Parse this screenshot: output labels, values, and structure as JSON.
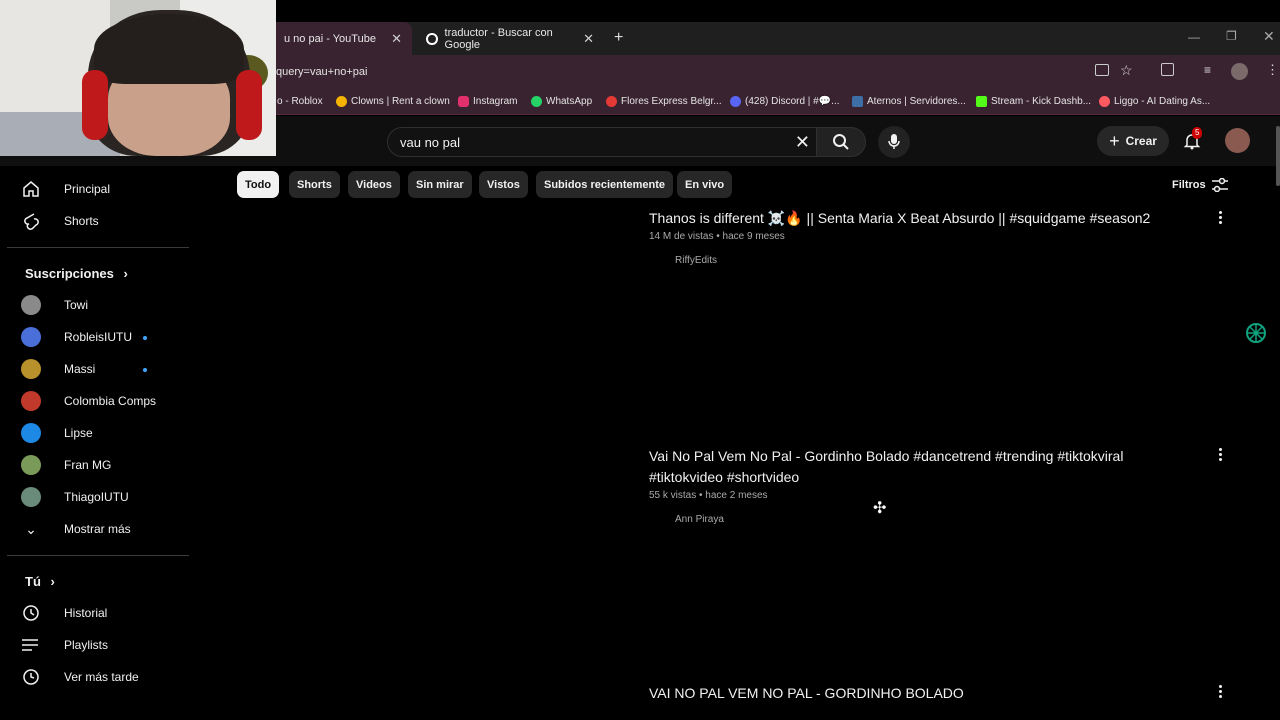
{
  "browser": {
    "tabs": [
      {
        "label": "u no pai - YouTube",
        "active": true
      },
      {
        "label": "traductor - Buscar con Google",
        "active": false
      }
    ],
    "address": "query=vau+no+pai",
    "bookmarks": [
      {
        "label": "o - Roblox",
        "color": "#888888"
      },
      {
        "label": "Clowns | Rent a clown",
        "color": "#f4b400"
      },
      {
        "label": "Instagram",
        "color": "#e1306c"
      },
      {
        "label": "WhatsApp",
        "color": "#25d366"
      },
      {
        "label": "Flores Express Belgr...",
        "color": "#e53935"
      },
      {
        "label": "(428) Discord | #💬...",
        "color": "#5865f2"
      },
      {
        "label": "Aternos | Servidores...",
        "color": "#3d6ea5"
      },
      {
        "label": "Stream - Kick Dashb...",
        "color": "#53fc18"
      },
      {
        "label": "Liggo - AI Dating As...",
        "color": "#ff5a5f"
      }
    ]
  },
  "header": {
    "search_value": "vau no pal",
    "create_label": "Crear",
    "notif_count": "5"
  },
  "chips": [
    "Todo",
    "Shorts",
    "Videos",
    "Sin mirar",
    "Vistos",
    "Subidos recientemente",
    "En vivo"
  ],
  "filters_label": "Filtros",
  "sidebar": {
    "main": [
      {
        "label": "Principal",
        "icon": "home-icon"
      },
      {
        "label": "Shorts",
        "icon": "shorts-icon"
      }
    ],
    "subs_heading": "Suscripciones",
    "subs": [
      {
        "label": "Towi",
        "color": "#8a8a8a",
        "dot": false
      },
      {
        "label": "RobleisIUTU",
        "color": "#4a6fd8",
        "dot": true
      },
      {
        "label": "Massi",
        "color": "#b8902c",
        "dot": true
      },
      {
        "label": "Colombia Comps",
        "color": "#c0392b",
        "dot": false
      },
      {
        "label": "Lipse",
        "color": "#1e88e5",
        "dot": false
      },
      {
        "label": "Fran MG",
        "color": "#7a9a5a",
        "dot": false
      },
      {
        "label": "ThiagoIUTU",
        "color": "#6a8a7a",
        "dot": false
      }
    ],
    "show_more": "Mostrar más",
    "you_heading": "Tú",
    "you": [
      {
        "label": "Historial",
        "icon": "history-icon"
      },
      {
        "label": "Playlists",
        "icon": "playlists-icon"
      },
      {
        "label": "Ver más tarde",
        "icon": "watch-later-icon"
      }
    ]
  },
  "results": [
    {
      "title": "Thanos is different ☠️🔥 || Senta Maria X Beat Absurdo || #squidgame #season2",
      "meta": "14 M de vistas • hace 9 meses",
      "channel": "RiffyEdits"
    },
    {
      "title": "Vai No Pal Vem No Pal - Gordinho Bolado #dancetrend #trending #tiktokviral #tiktokvideo #shortvideo",
      "meta": "55 k vistas • hace 2 meses",
      "channel": "Ann Piraya"
    },
    {
      "title": "VAI NO PAL VEM NO PAL - GORDINHO BOLADO",
      "meta": "",
      "channel": ""
    }
  ],
  "colors": {
    "accent": "#3ea6ff",
    "notif": "#cc0000",
    "sparkle": "#10a37f"
  }
}
